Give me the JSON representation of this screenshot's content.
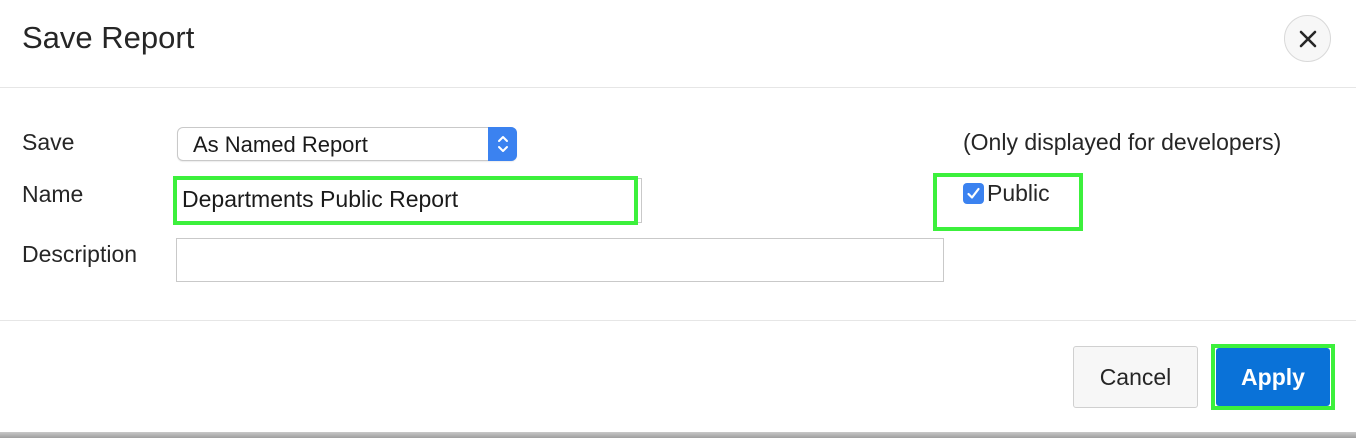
{
  "dialog": {
    "title": "Save Report",
    "close_icon": "close-icon"
  },
  "form": {
    "save_label": "Save",
    "save_value": "As Named Report",
    "name_label": "Name",
    "name_value": "Departments Public Report",
    "description_label": "Description",
    "description_value": "",
    "developer_note": "(Only displayed for developers)",
    "public_label": "Public",
    "public_checked": true
  },
  "footer": {
    "cancel_label": "Cancel",
    "apply_label": "Apply"
  },
  "colors": {
    "accent": "#0a72d8",
    "highlight": "#3cf03c"
  }
}
